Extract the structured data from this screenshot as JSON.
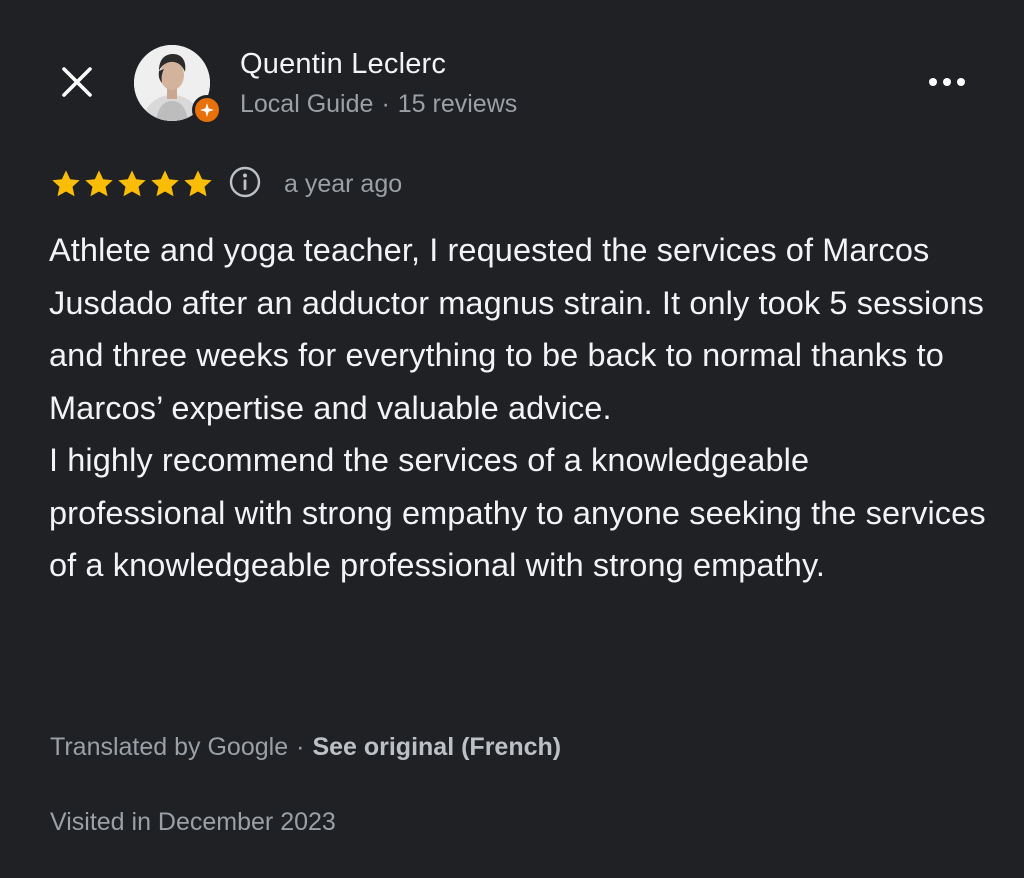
{
  "header": {
    "close_icon": "close-icon",
    "more_icon": "more-horizontal-icon"
  },
  "author": {
    "name": "Quentin Leclerc",
    "badge": "Local Guide",
    "separator": "·",
    "reviews": "15 reviews",
    "badge_color": "#e8710a"
  },
  "review": {
    "rating": 5,
    "max_rating": 5,
    "star_color": "#fbbc04",
    "date": "a year ago",
    "paragraphs": [
      "Athlete and yoga teacher, I requested the services of Marcos Jusdado after an adductor magnus strain. It only took 5 sessions and three weeks for everything to be back to normal thanks to Marcos’ expertise and valuable advice.",
      "I highly recommend the services of a knowledgeable professional with strong empathy to anyone seeking the services of a knowledgeable professional with strong empathy."
    ]
  },
  "translation": {
    "label": "Translated by Google",
    "separator": "·",
    "link": "See original (French)"
  },
  "visit": {
    "text": "Visited in December 2023"
  }
}
